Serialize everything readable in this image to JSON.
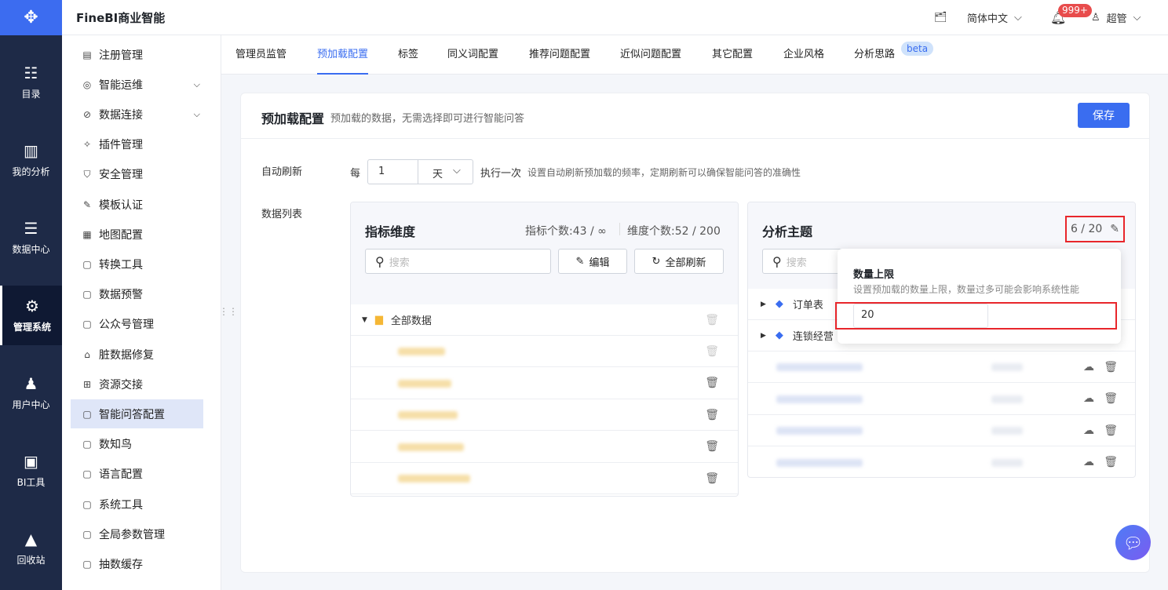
{
  "app": {
    "brand": "FineBI商业智能"
  },
  "rail": [
    {
      "label": "目录",
      "icon": "catalog-icon"
    },
    {
      "label": "我的分析",
      "icon": "analysis-icon"
    },
    {
      "label": "数据中心",
      "icon": "data-center-icon"
    },
    {
      "label": "管理系统",
      "icon": "gear-icon",
      "active": true
    },
    {
      "label": "用户中心",
      "icon": "user-icon"
    },
    {
      "label": "BI工具",
      "icon": "toolbox-icon"
    },
    {
      "label": "回收站",
      "icon": "recycle-icon"
    }
  ],
  "header": {
    "language": "简体中文",
    "notifications": "999+",
    "user": "超管"
  },
  "menu": [
    {
      "label": "注册管理"
    },
    {
      "label": "智能运维",
      "expandable": true
    },
    {
      "label": "数据连接",
      "expandable": true
    },
    {
      "label": "插件管理"
    },
    {
      "label": "安全管理"
    },
    {
      "label": "模板认证"
    },
    {
      "label": "地图配置"
    },
    {
      "label": "转换工具"
    },
    {
      "label": "数据预警"
    },
    {
      "label": "公众号管理"
    },
    {
      "label": "脏数据修复"
    },
    {
      "label": "资源交接"
    },
    {
      "label": "智能问答配置",
      "active": true
    },
    {
      "label": "数知鸟"
    },
    {
      "label": "语言配置"
    },
    {
      "label": "系统工具"
    },
    {
      "label": "全局参数管理"
    },
    {
      "label": "抽数缓存"
    }
  ],
  "tabs": [
    {
      "label": "管理员监管"
    },
    {
      "label": "预加载配置",
      "active": true
    },
    {
      "label": "标签"
    },
    {
      "label": "同义词配置"
    },
    {
      "label": "推荐问题配置"
    },
    {
      "label": "近似问题配置"
    },
    {
      "label": "其它配置"
    },
    {
      "label": "企业风格"
    },
    {
      "label": "分析思路"
    }
  ],
  "beta": "beta",
  "page": {
    "title": "预加载配置",
    "subtitle": "预加载的数据，无需选择即可进行智能问答",
    "save": "保存",
    "refresh_label": "自动刷新",
    "every": "每",
    "interval": "1",
    "unit": "天",
    "once": "执行一次",
    "refresh_hint": "设置自动刷新预加载的频率，定期刷新可以确保智能问答的准确性",
    "list_label": "数据列表"
  },
  "left_panel": {
    "title": "指标维度",
    "metric_count": "指标个数:43 / ∞",
    "dim_count": "维度个数:52 / 200",
    "search_placeholder": "搜索",
    "edit": "编辑",
    "refresh_all": "全部刷新",
    "root": "全部数据"
  },
  "right_panel": {
    "title": "分析主题",
    "count": "6 / 20",
    "search_placeholder": "搜索",
    "items": [
      "订单表",
      "连锁经营"
    ]
  },
  "popover": {
    "title": "数量上限",
    "desc": "设置预加载的数量上限，数量过多可能会影响系统性能",
    "value": "20"
  },
  "colors": {
    "accent": "#3a6df0",
    "rail": "#1e2a47",
    "highlight": "#e8262b"
  }
}
